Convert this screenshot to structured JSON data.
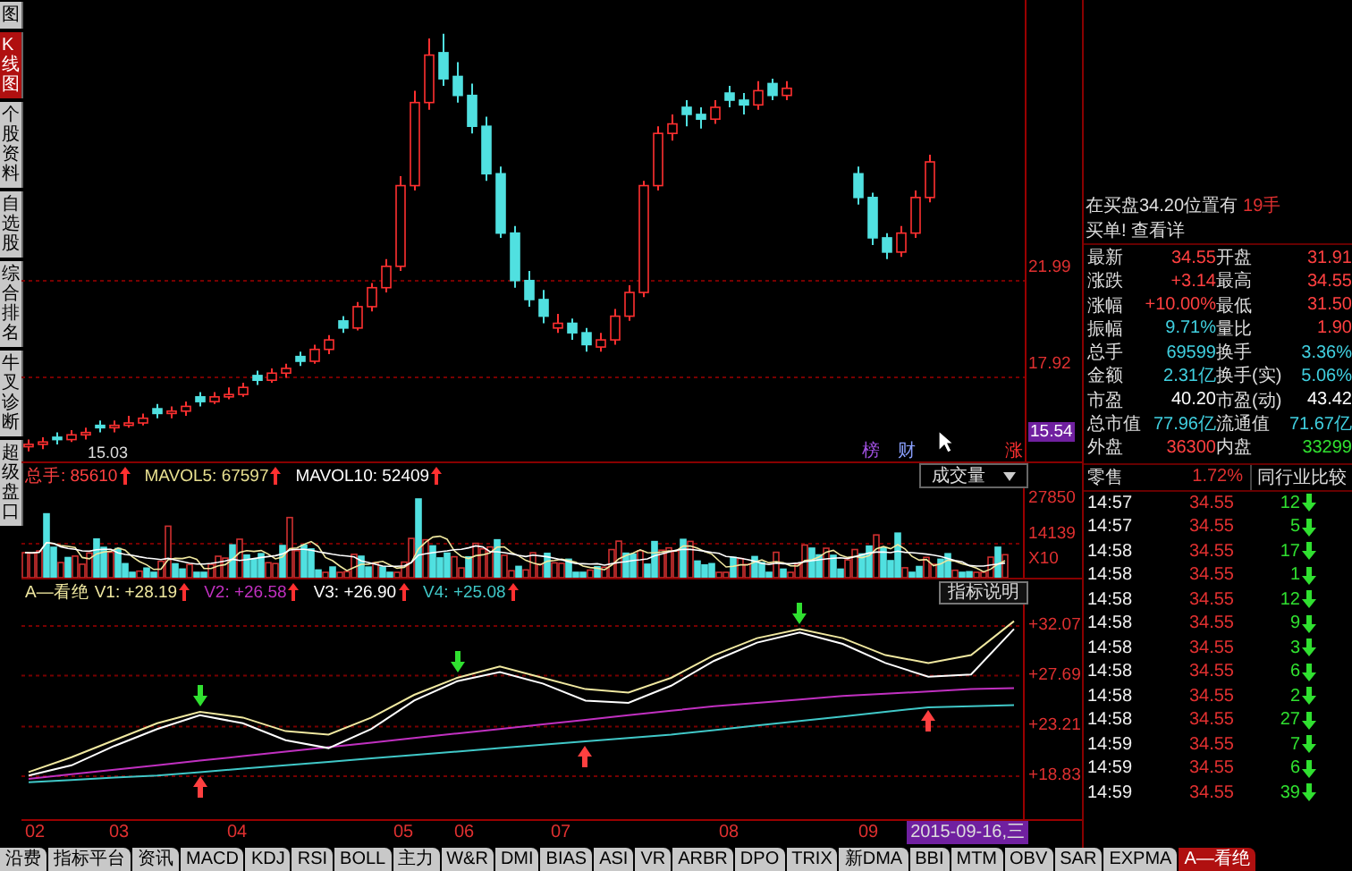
{
  "sidebar": {
    "tabs": [
      {
        "label": "图",
        "selected": false
      },
      {
        "label": "K线图",
        "selected": true
      },
      {
        "label": "个股资料",
        "selected": false
      },
      {
        "label": "自选股",
        "selected": false
      },
      {
        "label": "综合排名",
        "selected": false
      },
      {
        "label": "牛叉诊断",
        "selected": false
      },
      {
        "label": "超级盘口",
        "selected": false
      }
    ]
  },
  "price_chart": {
    "start_label": "15.03",
    "current_price": "15.54",
    "markers": [
      {
        "text": "榜",
        "color": "#a050e0"
      },
      {
        "text": "财",
        "color": "#8aa0ff"
      },
      {
        "text": "涨",
        "color": "#ff3030"
      }
    ],
    "chart_data": {
      "type": "candlestick",
      "grid": true,
      "ylim": [
        14.38,
        33.82
      ],
      "yticks": [
        21.99,
        17.92
      ],
      "ohlc": [
        [
          15.0,
          15.3,
          14.8,
          15.1
        ],
        [
          15.1,
          15.4,
          14.9,
          15.2
        ],
        [
          15.4,
          15.6,
          15.1,
          15.3
        ],
        [
          15.3,
          15.7,
          15.2,
          15.5
        ],
        [
          15.5,
          15.8,
          15.3,
          15.6
        ],
        [
          15.9,
          16.1,
          15.6,
          15.8
        ],
        [
          15.8,
          16.1,
          15.6,
          15.9
        ],
        [
          15.9,
          16.3,
          15.8,
          16.0
        ],
        [
          16.0,
          16.4,
          15.9,
          16.2
        ],
        [
          16.6,
          16.8,
          16.2,
          16.4
        ],
        [
          16.4,
          16.7,
          16.2,
          16.5
        ],
        [
          16.5,
          16.9,
          16.3,
          16.7
        ],
        [
          17.1,
          17.3,
          16.7,
          16.9
        ],
        [
          16.9,
          17.3,
          16.8,
          17.1
        ],
        [
          17.1,
          17.5,
          17.0,
          17.2
        ],
        [
          17.2,
          17.7,
          17.1,
          17.5
        ],
        [
          18.0,
          18.2,
          17.6,
          17.8
        ],
        [
          17.8,
          18.3,
          17.7,
          18.1
        ],
        [
          18.1,
          18.5,
          17.9,
          18.3
        ],
        [
          18.8,
          19.0,
          18.4,
          18.6
        ],
        [
          18.6,
          19.3,
          18.5,
          19.1
        ],
        [
          19.1,
          19.7,
          18.9,
          19.5
        ],
        [
          20.3,
          20.5,
          19.8,
          20.0
        ],
        [
          20.0,
          21.1,
          19.9,
          20.9
        ],
        [
          20.9,
          21.9,
          20.7,
          21.7
        ],
        [
          21.7,
          22.9,
          21.5,
          22.6
        ],
        [
          22.6,
          26.4,
          22.4,
          26.0
        ],
        [
          26.0,
          30.0,
          25.8,
          29.5
        ],
        [
          29.5,
          32.2,
          29.2,
          31.5
        ],
        [
          31.6,
          32.4,
          30.2,
          30.5
        ],
        [
          30.6,
          31.2,
          29.5,
          29.8
        ],
        [
          29.8,
          30.3,
          28.2,
          28.5
        ],
        [
          28.5,
          28.9,
          26.2,
          26.5
        ],
        [
          26.5,
          26.8,
          23.8,
          24.0
        ],
        [
          24.0,
          24.3,
          21.7,
          22.0
        ],
        [
          22.0,
          22.4,
          20.9,
          21.2
        ],
        [
          21.2,
          21.6,
          20.2,
          20.5
        ],
        [
          20.0,
          20.6,
          19.8,
          20.2
        ],
        [
          20.2,
          20.4,
          19.5,
          19.8
        ],
        [
          19.8,
          20.0,
          19.0,
          19.3
        ],
        [
          19.2,
          19.8,
          19.0,
          19.5
        ],
        [
          19.5,
          20.8,
          19.3,
          20.5
        ],
        [
          20.5,
          21.8,
          20.3,
          21.5
        ],
        [
          21.5,
          26.2,
          21.3,
          26.0
        ],
        [
          26.0,
          28.5,
          25.8,
          28.2
        ],
        [
          28.2,
          29.0,
          27.9,
          28.6
        ],
        [
          29.3,
          29.6,
          28.5,
          29.0
        ],
        [
          29.0,
          29.3,
          28.4,
          28.8
        ],
        [
          28.8,
          29.6,
          28.6,
          29.3
        ],
        [
          29.9,
          30.2,
          29.3,
          29.6
        ],
        [
          29.6,
          29.9,
          29.0,
          29.4
        ],
        [
          29.4,
          30.4,
          29.2,
          30.0
        ],
        [
          30.3,
          30.5,
          29.6,
          29.8
        ],
        [
          29.8,
          30.4,
          29.6,
          30.1
        ],
        null,
        null,
        null,
        null,
        [
          26.5,
          26.8,
          25.2,
          25.5
        ],
        [
          25.5,
          25.7,
          23.5,
          23.8
        ],
        [
          23.8,
          24.0,
          22.9,
          23.2
        ],
        [
          23.2,
          24.3,
          23.0,
          24.0
        ],
        [
          24.0,
          25.8,
          23.8,
          25.5
        ],
        [
          25.5,
          27.3,
          25.3,
          27.0
        ]
      ]
    }
  },
  "volume": {
    "legend": [
      {
        "text": "总手: 85610",
        "color": "#ff4040"
      },
      {
        "text": "MAVOL5: 67597",
        "color": "#e8e090"
      },
      {
        "text": "MAVOL10: 52409",
        "color": "#ffffff"
      }
    ],
    "dropdown": "成交量",
    "axis_labels": [
      "27850",
      "14139",
      "X10"
    ]
  },
  "indicator": {
    "title": "A—看绝",
    "readings": [
      ": +28.19",
      ": +26.58",
      ": +26.90",
      ": +25.08"
    ],
    "help_button": "指标说明",
    "chart_data": {
      "type": "line",
      "grid": true,
      "ylim": [
        15.05,
        33.96
      ],
      "yticks": [
        {
          "value": 32.07,
          "label": "+32.07"
        },
        {
          "value": 27.69,
          "label": "+27.69"
        },
        {
          "value": 23.21,
          "label": "+23.21"
        },
        {
          "value": 18.83,
          "label": "+18.83"
        }
      ],
      "series": [
        {
          "name": "V1",
          "color": "#f0e8a0",
          "values": [
            19.2,
            20.5,
            22.0,
            23.5,
            24.5,
            24.0,
            22.8,
            22.5,
            24.0,
            26.0,
            27.5,
            28.5,
            27.5,
            26.5,
            26.2,
            27.5,
            29.5,
            31.0,
            31.8,
            31.0,
            29.5,
            28.8,
            29.5,
            32.5
          ]
        },
        {
          "name": "V2",
          "color": "#c030c0",
          "values": [
            18.6,
            19.0,
            19.4,
            19.8,
            20.2,
            20.6,
            21.0,
            21.4,
            21.8,
            22.2,
            22.6,
            23.0,
            23.4,
            23.8,
            24.2,
            24.6,
            25.0,
            25.3,
            25.6,
            25.9,
            26.1,
            26.3,
            26.5,
            26.6
          ]
        },
        {
          "name": "V3",
          "color": "#ffffff",
          "values": [
            18.9,
            19.8,
            21.5,
            23.0,
            24.2,
            23.5,
            22.0,
            21.3,
            23.0,
            25.5,
            27.2,
            28.0,
            27.0,
            25.5,
            25.3,
            26.8,
            29.0,
            30.6,
            31.5,
            30.5,
            28.8,
            27.6,
            27.8,
            31.8
          ]
        },
        {
          "name": "V4",
          "color": "#40c8c8",
          "values": [
            18.3,
            18.5,
            18.7,
            18.9,
            19.2,
            19.5,
            19.8,
            20.1,
            20.4,
            20.7,
            21.0,
            21.3,
            21.6,
            21.9,
            22.2,
            22.5,
            22.9,
            23.3,
            23.7,
            24.1,
            24.5,
            24.9,
            25.0,
            25.1
          ]
        }
      ]
    }
  },
  "dates": {
    "labels": [
      "02",
      "03",
      "04",
      "05",
      "06",
      "07",
      "08",
      "09"
    ],
    "current": "2015-09-16,三"
  },
  "bottom_tabs": [
    {
      "label": "沿费",
      "selected": false
    },
    {
      "label": "指标平台",
      "selected": false
    },
    {
      "label": "资讯",
      "selected": false
    },
    {
      "label": "MACD",
      "selected": false
    },
    {
      "label": "KDJ",
      "selected": false
    },
    {
      "label": "RSI",
      "selected": false
    },
    {
      "label": "BOLL",
      "selected": false
    },
    {
      "label": "主力",
      "selected": false
    },
    {
      "label": "W&R",
      "selected": false
    },
    {
      "label": "DMI",
      "selected": false
    },
    {
      "label": "BIAS",
      "selected": false
    },
    {
      "label": "ASI",
      "selected": false
    },
    {
      "label": "VR",
      "selected": false
    },
    {
      "label": "ARBR",
      "selected": false
    },
    {
      "label": "DPO",
      "selected": false
    },
    {
      "label": "TRIX",
      "selected": false
    },
    {
      "label": "新DMA",
      "selected": false
    },
    {
      "label": "BBI",
      "selected": false
    },
    {
      "label": "MTM",
      "selected": false
    },
    {
      "label": "OBV",
      "selected": false
    },
    {
      "label": "SAR",
      "selected": false
    },
    {
      "label": "EXPMA",
      "selected": false
    },
    {
      "label": "A—看绝",
      "selected": true
    }
  ],
  "quote": {
    "header": [
      "在买盘34.20位置有",
      "19手",
      "买单! 查看详"
    ],
    "rows": [
      [
        {
          "label": "最新",
          "value": "34.55",
          "color": "#ff4040"
        },
        {
          "label": "开盘",
          "value": "31.91",
          "color": "#ff4040"
        }
      ],
      [
        {
          "label": "涨跌",
          "value": "+3.14",
          "color": "#ff4040"
        },
        {
          "label": "最高",
          "value": "34.55",
          "color": "#ff4040"
        }
      ],
      [
        {
          "label": "涨幅",
          "value": "+10.00%",
          "color": "#ff4040"
        },
        {
          "label": "最低",
          "value": "31.50",
          "color": "#ff4040"
        }
      ],
      [
        {
          "label": "振幅",
          "value": "9.71%",
          "color": "#40d0e0"
        },
        {
          "label": "量比",
          "value": "1.90",
          "color": "#ff4040"
        }
      ],
      [
        {
          "label": "总手",
          "value": "69599",
          "color": "#40d0e0"
        },
        {
          "label": "换手",
          "value": "3.36%",
          "color": "#40d0e0"
        }
      ],
      [
        {
          "label": "金额",
          "value": "2.31亿",
          "color": "#40d0e0"
        },
        {
          "label": "换手(实)",
          "value": "5.06%",
          "color": "#40d0e0"
        }
      ],
      [
        {
          "label": "市盈",
          "value": "40.20",
          "color": "#ffffff"
        },
        {
          "label": "市盈(动)",
          "value": "43.42",
          "color": "#ffffff"
        }
      ],
      [
        {
          "label": "总市值",
          "value": "77.96亿",
          "color": "#40d0e0"
        },
        {
          "label": "流通值",
          "value": "71.67亿",
          "color": "#40d0e0"
        }
      ],
      [
        {
          "label": "外盘",
          "value": "36300",
          "color": "#ff4040"
        },
        {
          "label": "内盘",
          "value": "33299",
          "color": "#30e030"
        }
      ]
    ]
  },
  "sector": {
    "label": "零售",
    "value": "1.72%",
    "button": "同行业比较"
  },
  "trades": [
    {
      "time": "14:57",
      "price": "34.55",
      "volume": "12"
    },
    {
      "time": "14:57",
      "price": "34.55",
      "volume": "5"
    },
    {
      "time": "14:58",
      "price": "34.55",
      "volume": "17"
    },
    {
      "time": "14:58",
      "price": "34.55",
      "volume": "1"
    },
    {
      "time": "14:58",
      "price": "34.55",
      "volume": "12"
    },
    {
      "time": "14:58",
      "price": "34.55",
      "volume": "9"
    },
    {
      "time": "14:58",
      "price": "34.55",
      "volume": "3"
    },
    {
      "time": "14:58",
      "price": "34.55",
      "volume": "6"
    },
    {
      "time": "14:58",
      "price": "34.55",
      "volume": "2"
    },
    {
      "time": "14:58",
      "price": "34.55",
      "volume": "27"
    },
    {
      "time": "14:59",
      "price": "34.55",
      "volume": "7"
    },
    {
      "time": "14:59",
      "price": "34.55",
      "volume": "6"
    },
    {
      "time": "14:59",
      "price": "34.55",
      "volume": "39"
    }
  ]
}
